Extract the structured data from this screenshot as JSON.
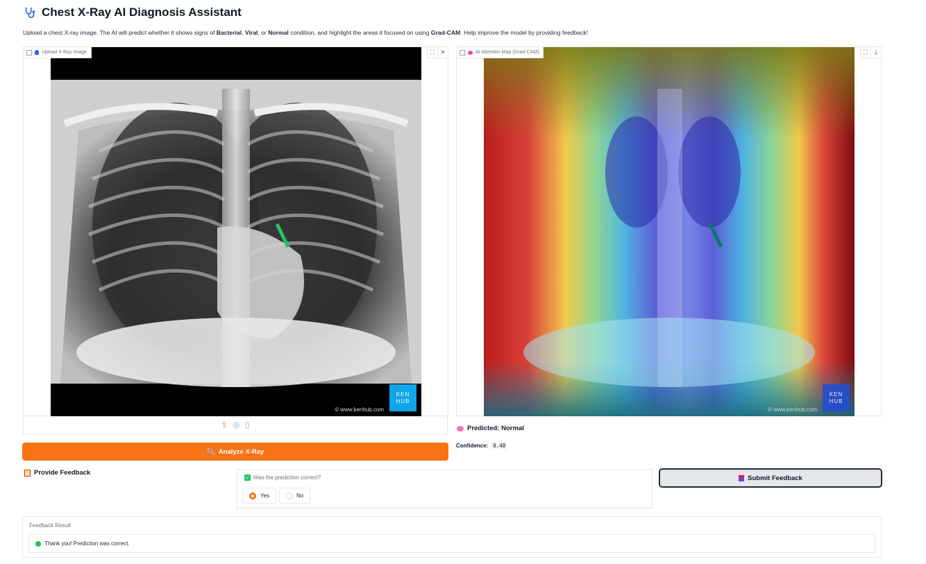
{
  "app": {
    "title": "Chest X-Ray AI Diagnosis Assistant",
    "description_parts": {
      "p1": "Upload a chest X-ray image. The AI will predict whether it shows signs of ",
      "b1": "Bacterial",
      "p2": ", ",
      "b2": "Viral",
      "p3": ", or ",
      "b3": "Normal",
      "p4": " condition, and highlight the areas it focused on using ",
      "b4": "Grad-CAM",
      "p5": ". Help improve the model by providing feedback!"
    }
  },
  "upload_panel": {
    "label": "Upload X-Ray Image",
    "watermark_logo": [
      "KEN",
      "HUB"
    ],
    "watermark_url": "© www.kenhub.com",
    "icons": [
      "fullscreen-icon",
      "close-icon",
      "upload-icon",
      "webcam-icon",
      "clipboard-icon"
    ]
  },
  "gradcam_panel": {
    "label": "AI Attention Map (Grad-CAM)",
    "watermark_logo": [
      "KEN",
      "HUB"
    ],
    "watermark_url": "© www.kenhub.com",
    "icons": [
      "fullscreen-icon",
      "download-icon"
    ]
  },
  "analyze_button": {
    "label": "Analyze X-Ray",
    "icon": "magnifier-icon"
  },
  "prediction": {
    "text": "Predicted: Normal",
    "confidence_label": "Confidence:",
    "confidence_value": "0.48"
  },
  "feedback": {
    "section_title": "Provide Feedback",
    "question": "Was the prediction correct?",
    "options": [
      {
        "label": "Yes",
        "selected": true
      },
      {
        "label": "No",
        "selected": false
      }
    ],
    "submit_label": "Submit Feedback",
    "result_label": "Feedback Result",
    "result_text": "Thank you! Prediction was correct."
  },
  "colors": {
    "accent": "#f97316",
    "success": "#22c55e",
    "kenhub_blue": "#0ea5e9"
  }
}
